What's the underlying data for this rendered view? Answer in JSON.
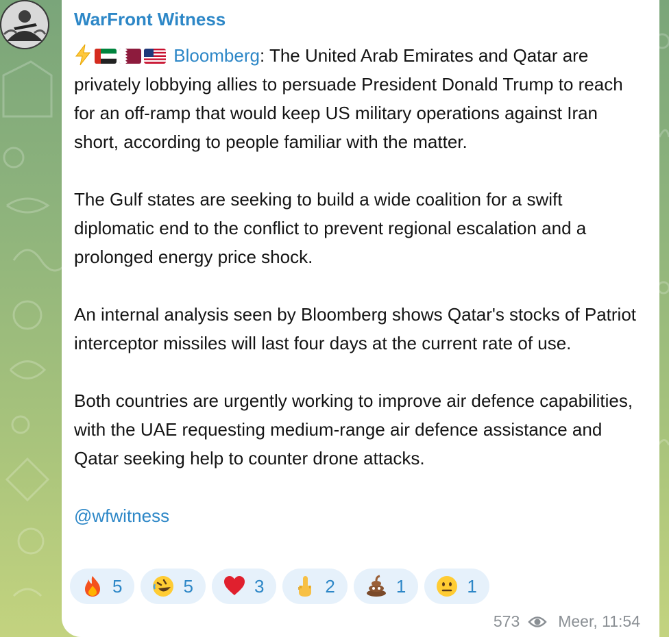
{
  "channel": {
    "name": "WarFront Witness",
    "avatar": "channel-avatar"
  },
  "message": {
    "prefix_icons": [
      "lightning-icon",
      "uae-flag-icon",
      "qatar-flag-icon",
      "us-flag-icon"
    ],
    "source_link": "Bloomberg",
    "para1_rest": ": The United Arab Emirates and Qatar are privately lobbying allies to persuade President Donald Trump to reach for an off-ramp that would keep US military operations against Iran short, according to people familiar with the matter.",
    "para2": "The Gulf states are seeking to build a wide coalition for a swift diplomatic end to the conflict to prevent regional escalation and a prolonged energy price shock.",
    "para3": "An internal analysis seen by Bloomberg shows Qatar's stocks of Patriot interceptor missiles will last four days at the current rate of use.",
    "para4": "Both countries are urgently working to improve air defence capabilities, with the UAE requesting medium-range air defence assistance and Qatar seeking help to counter drone attacks.",
    "handle": "@wfwitness"
  },
  "reactions": [
    {
      "icon": "fire-emoji",
      "count": "5"
    },
    {
      "icon": "rofl-emoji",
      "count": "5"
    },
    {
      "icon": "heart-emoji",
      "count": "3"
    },
    {
      "icon": "middle-finger-emoji",
      "count": "2"
    },
    {
      "icon": "poop-emoji",
      "count": "1"
    },
    {
      "icon": "neutral-face-emoji",
      "count": "1"
    }
  ],
  "footer": {
    "views": "573",
    "view_icon": "eye-icon",
    "timestamp": "Meer, 11:54"
  },
  "colors": {
    "accent": "#2d87c7",
    "reaction_bg": "#e6f1fb",
    "meta_text": "#8a8f94"
  }
}
